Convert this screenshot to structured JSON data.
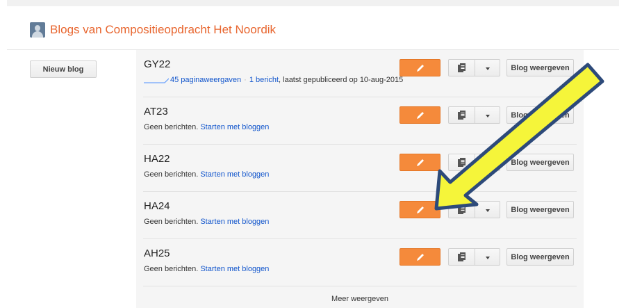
{
  "header": {
    "title": "Blogs van Compositieopdracht Het Noordik"
  },
  "sidebar": {
    "new_blog_label": "Nieuw blog"
  },
  "blogs": [
    {
      "name": "GY22",
      "pageviews": "45 paginaweergaven",
      "posts": "1 bericht",
      "last_published": ", laatst gepubliceerd op 10-aug-2015",
      "view_label": "Blog weergeven"
    },
    {
      "name": "AT23",
      "no_posts": "Geen berichten.",
      "start_link": "Starten met bloggen",
      "view_label": "Blog weergeven"
    },
    {
      "name": "HA22",
      "no_posts": "Geen berichten.",
      "start_link": "Starten met bloggen",
      "view_label": "Blog weergeven"
    },
    {
      "name": "HA24",
      "no_posts": "Geen berichten.",
      "start_link": "Starten met bloggen",
      "view_label": "Blog weergeven"
    },
    {
      "name": "AH25",
      "no_posts": "Geen berichten.",
      "start_link": "Starten met bloggen",
      "view_label": "Blog weergeven"
    }
  ],
  "footer": {
    "more_label": "Meer weergeven"
  },
  "colors": {
    "accent": "#e8652e",
    "edit_button": "#f58a3b",
    "link": "#1155cc",
    "annotation_arrow_fill": "#f5f53a",
    "annotation_arrow_stroke": "#2d4a7a"
  },
  "icons": [
    "profile-avatar-icon",
    "pencil-icon",
    "copy-icon",
    "chevron-down-icon"
  ]
}
